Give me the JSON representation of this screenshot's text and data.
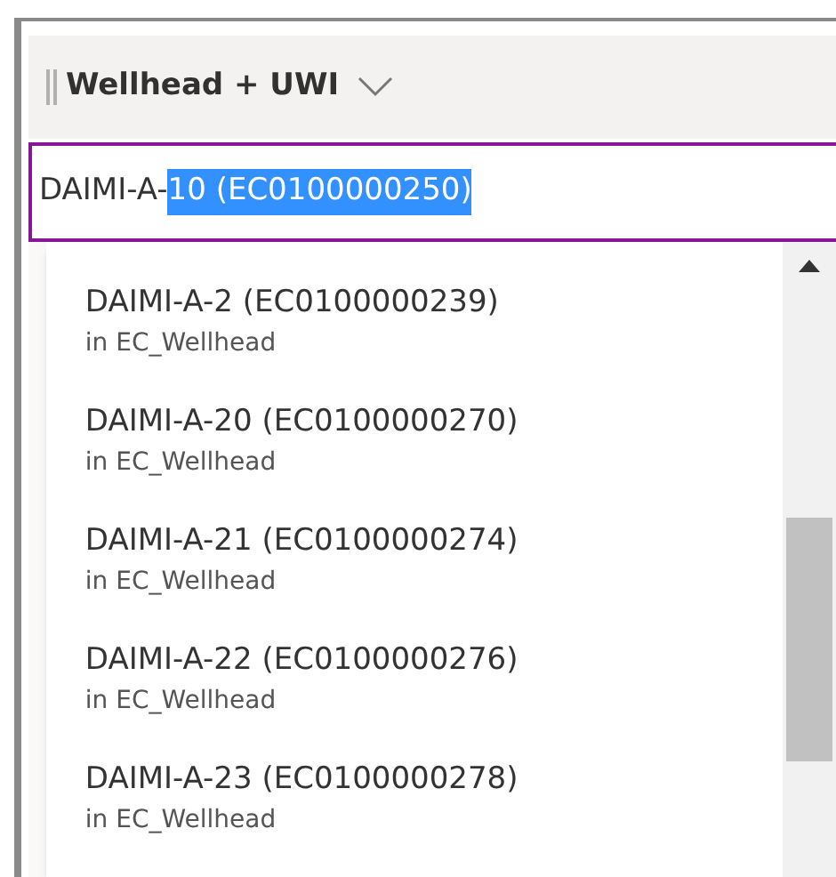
{
  "column_header": {
    "label": "Wellhead + UWI"
  },
  "search_input": {
    "text": "DAIMI-A-",
    "selected_text": "10 (EC0100000250)"
  },
  "suggestions": [
    {
      "title": "DAIMI-A-2 (EC0100000239)",
      "subtitle": "in EC_Wellhead"
    },
    {
      "title": "DAIMI-A-20 (EC0100000270)",
      "subtitle": "in EC_Wellhead"
    },
    {
      "title": "DAIMI-A-21 (EC0100000274)",
      "subtitle": "in EC_Wellhead"
    },
    {
      "title": "DAIMI-A-22 (EC0100000276)",
      "subtitle": "in EC_Wellhead"
    },
    {
      "title": "DAIMI-A-23 (EC0100000278)",
      "subtitle": "in EC_Wellhead"
    }
  ]
}
